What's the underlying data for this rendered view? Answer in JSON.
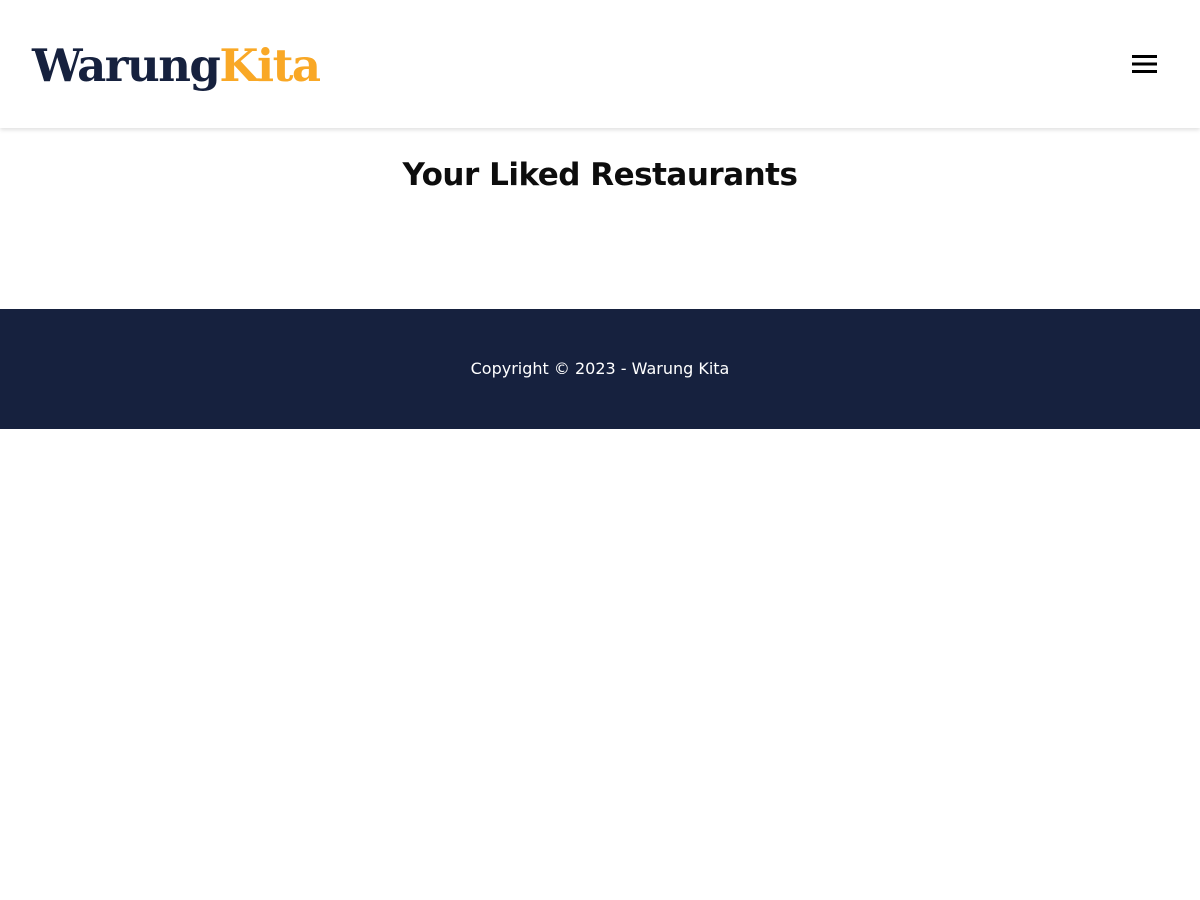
{
  "header": {
    "logo_primary": "Warung",
    "logo_accent": "Kita",
    "menu_icon": "hamburger-menu-icon",
    "menu_label": "Menu"
  },
  "main": {
    "title": "Your Liked Restaurants"
  },
  "footer": {
    "copyright": "Copyright © 2023 - Warung Kita"
  },
  "colors": {
    "brand_dark": "#16213e",
    "brand_accent": "#f9a826",
    "background": "#ffffff",
    "footer_text": "#ffffff"
  }
}
